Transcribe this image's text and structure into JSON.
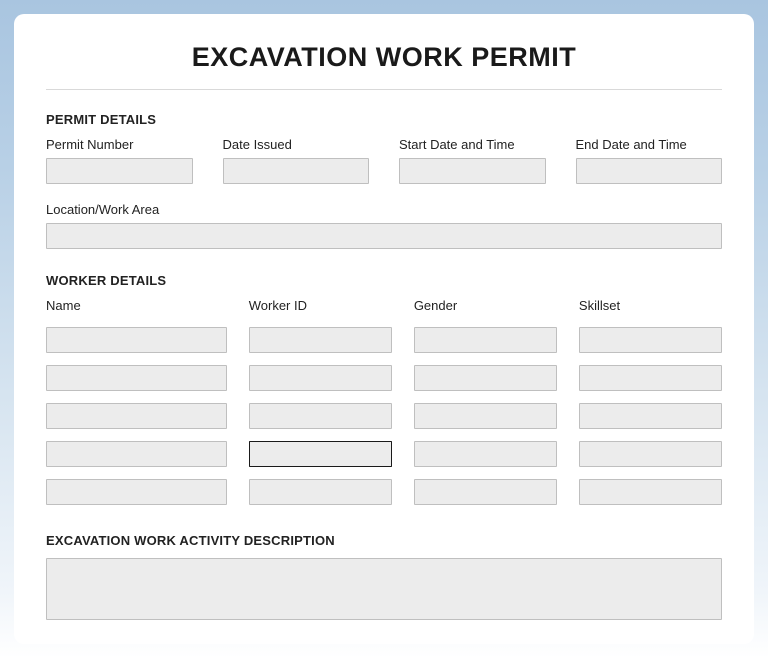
{
  "title": "EXCAVATION WORK PERMIT",
  "sections": {
    "permit_details": {
      "heading": "PERMIT DETAILS",
      "fields": {
        "permit_number": {
          "label": "Permit Number",
          "value": ""
        },
        "date_issued": {
          "label": "Date Issued",
          "value": ""
        },
        "start_datetime": {
          "label": "Start Date and Time",
          "value": ""
        },
        "end_datetime": {
          "label": "End Date and Time",
          "value": ""
        },
        "location": {
          "label": "Location/Work Area",
          "value": ""
        }
      }
    },
    "worker_details": {
      "heading": "WORKER DETAILS",
      "columns": {
        "name": "Name",
        "worker_id": "Worker ID",
        "gender": "Gender",
        "skillset": "Skillset"
      },
      "rows": [
        {
          "name": "",
          "worker_id": "",
          "gender": "",
          "skillset": ""
        },
        {
          "name": "",
          "worker_id": "",
          "gender": "",
          "skillset": ""
        },
        {
          "name": "",
          "worker_id": "",
          "gender": "",
          "skillset": ""
        },
        {
          "name": "",
          "worker_id": "",
          "gender": "",
          "skillset": ""
        },
        {
          "name": "",
          "worker_id": "",
          "gender": "",
          "skillset": ""
        }
      ],
      "focused_cell": {
        "row": 3,
        "col": "worker_id"
      }
    },
    "activity": {
      "heading": "EXCAVATION WORK ACTIVITY DESCRIPTION",
      "value": ""
    }
  }
}
